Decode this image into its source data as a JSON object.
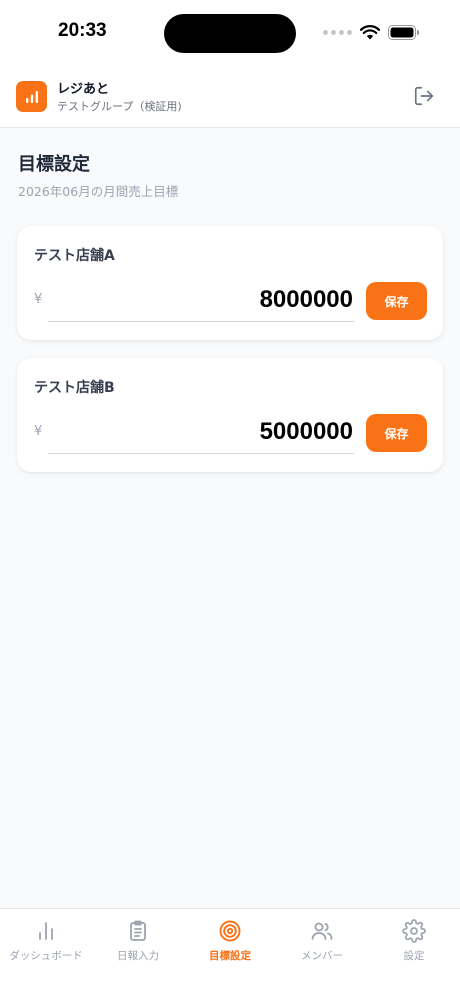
{
  "status_bar": {
    "time": "20:33"
  },
  "header": {
    "app_name": "レジあと",
    "group_name": "テストグループ（検証用)",
    "logo_icon": "bar-chart-icon",
    "logout_icon": "logout-icon"
  },
  "page": {
    "title": "目標設定",
    "subtitle": "2026年06月の月間売上目標"
  },
  "currency_symbol": "¥",
  "stores": [
    {
      "name": "テスト店舗A",
      "target": "8000000",
      "save_label": "保存"
    },
    {
      "name": "テスト店舗B",
      "target": "5000000",
      "save_label": "保存"
    }
  ],
  "nav": {
    "items": [
      {
        "label": "ダッシュボード",
        "icon": "bar-chart-icon",
        "active": false
      },
      {
        "label": "日報入力",
        "icon": "clipboard-icon",
        "active": false
      },
      {
        "label": "目標設定",
        "icon": "target-icon",
        "active": true
      },
      {
        "label": "メンバー",
        "icon": "users-icon",
        "active": false
      },
      {
        "label": "設定",
        "icon": "gear-icon",
        "active": false
      }
    ]
  },
  "colors": {
    "accent": "#f97316",
    "inactive": "#9ca3af",
    "background": "#f8fafc"
  }
}
